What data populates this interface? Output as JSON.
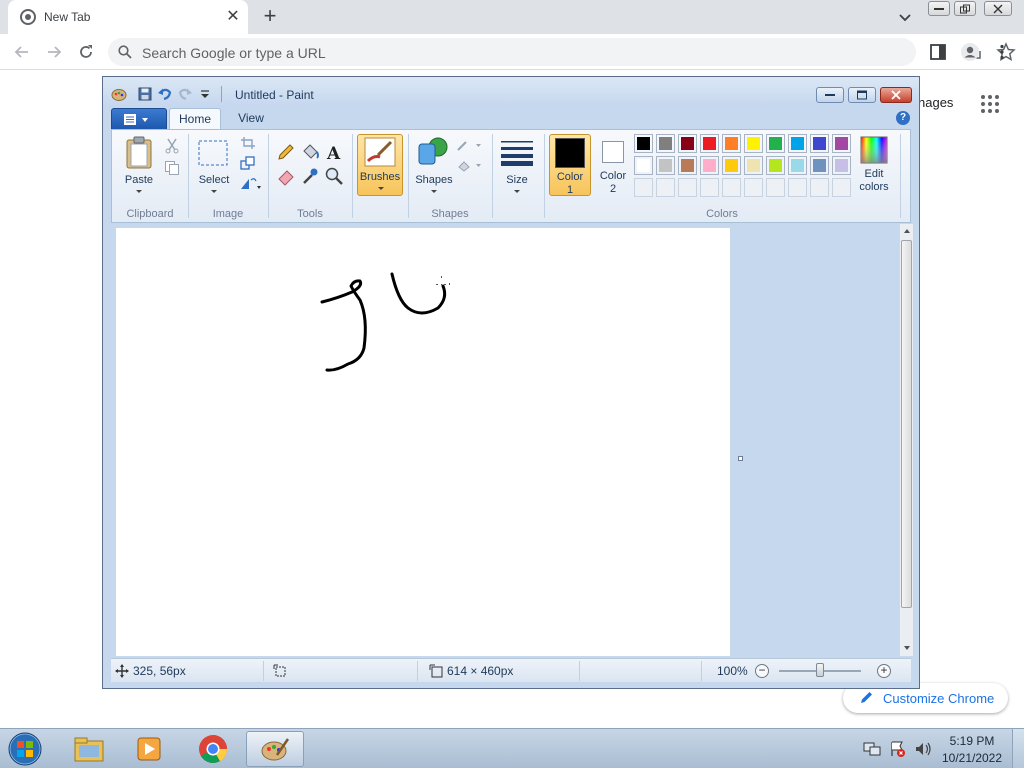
{
  "browser": {
    "tab_title": "New Tab",
    "new_tab_label": "+",
    "omnibox_placeholder": "Search Google or type a URL",
    "ntp_images_link": "nages",
    "customize_label": "Customize Chrome"
  },
  "paint": {
    "title": "Untitled - Paint",
    "tabs": {
      "home": "Home",
      "view": "View"
    },
    "help_label": "?",
    "groups": {
      "clipboard": "Clipboard",
      "image": "Image",
      "tools": "Tools",
      "shapes": "Shapes",
      "colors": "Colors"
    },
    "buttons": {
      "paste": "Paste",
      "select": "Select",
      "brushes": "Brushes",
      "shapes": "Shapes",
      "size": "Size",
      "edit_colors_1": "Edit",
      "edit_colors_2": "colors"
    },
    "color1": {
      "line1": "Color",
      "line2": "1",
      "value": "#000000"
    },
    "color2": {
      "line1": "Color",
      "line2": "2",
      "value": "#ffffff"
    },
    "palette": [
      [
        "#000000",
        "#7f7f7f",
        "#880015",
        "#ed1c24",
        "#ff7f27",
        "#fff200",
        "#22b14c",
        "#00a2e8",
        "#3f48cc",
        "#a349a4"
      ],
      [
        "#ffffff",
        "#c3c3c3",
        "#b97a57",
        "#ffaec9",
        "#ffc90e",
        "#efe4b0",
        "#b5e61d",
        "#99d9ea",
        "#7092be",
        "#c8bfe7"
      ]
    ],
    "status": {
      "cursor_pos": "325, 56px",
      "image_size": "614 × 460px",
      "zoom": "100%",
      "zoom_fraction": 0.5
    }
  },
  "taskbar": {
    "time": "5:19 PM",
    "date": "10/21/2022"
  }
}
